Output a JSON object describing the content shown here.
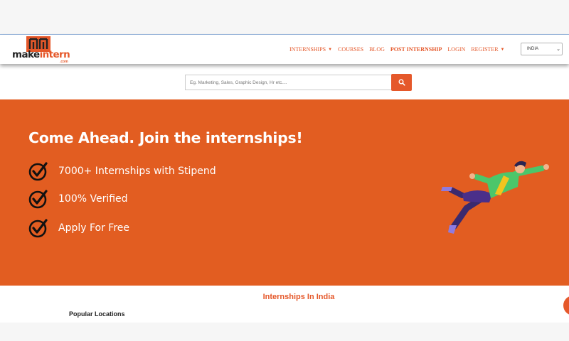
{
  "brand": {
    "logo_word_1": "make",
    "logo_word_2": "intern",
    "logo_sub": ".com",
    "accent_color": "#e5582a"
  },
  "nav": {
    "items": [
      {
        "label": "INTERNSHIPS",
        "dropdown": true
      },
      {
        "label": "COURSES",
        "dropdown": false
      },
      {
        "label": "BLOG",
        "dropdown": false
      },
      {
        "label": "POST INTERNSHIP",
        "dropdown": false
      },
      {
        "label": "LOGIN",
        "dropdown": false
      },
      {
        "label": "REGISTER",
        "dropdown": true
      }
    ],
    "country_select": "INDIA"
  },
  "search": {
    "placeholder": "Eg. Marketing, Sales, Graphic Design, Hr etc....",
    "button_icon": "search-icon"
  },
  "hero": {
    "title": "Come Ahead. Join the internships!",
    "features": [
      "7000+ Internships with Stipend",
      "100% Verified",
      "Apply For Free"
    ],
    "background_color": "#e25d21"
  },
  "section": {
    "title": "Internships In India",
    "popular_locations": "Popular Locations"
  }
}
